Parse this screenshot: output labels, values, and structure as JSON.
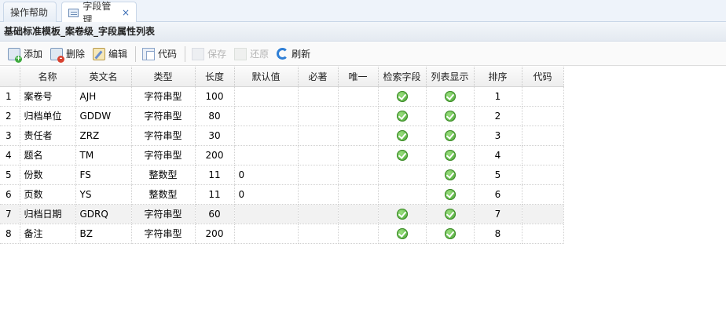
{
  "tabs": [
    {
      "label": "操作帮助"
    },
    {
      "label": "字段管理",
      "close": "×"
    }
  ],
  "panel": {
    "title": "基础标准模板_案卷级_字段属性列表"
  },
  "toolbar": {
    "add": "添加",
    "delete": "删除",
    "edit": "编辑",
    "code": "代码",
    "save": "保存",
    "revert": "还原",
    "refresh": "刷新"
  },
  "grid": {
    "columns": [
      "名称",
      "英文名",
      "类型",
      "长度",
      "默认值",
      "必著",
      "唯一",
      "检索字段",
      "列表显示",
      "排序",
      "代码"
    ],
    "rows": [
      {
        "n": "1",
        "name": "案卷号",
        "en": "AJH",
        "type": "字符串型",
        "len": "100",
        "def": "",
        "search": true,
        "list": true,
        "order": "1"
      },
      {
        "n": "2",
        "name": "归档单位",
        "en": "GDDW",
        "type": "字符串型",
        "len": "80",
        "def": "",
        "search": true,
        "list": true,
        "order": "2"
      },
      {
        "n": "3",
        "name": "责任者",
        "en": "ZRZ",
        "type": "字符串型",
        "len": "30",
        "def": "",
        "search": true,
        "list": true,
        "order": "3"
      },
      {
        "n": "4",
        "name": "题名",
        "en": "TM",
        "type": "字符串型",
        "len": "200",
        "def": "",
        "search": true,
        "list": true,
        "order": "4"
      },
      {
        "n": "5",
        "name": "份数",
        "en": "FS",
        "type": "整数型",
        "len": "11",
        "def": "0",
        "search": false,
        "list": true,
        "order": "5"
      },
      {
        "n": "6",
        "name": "页数",
        "en": "YS",
        "type": "整数型",
        "len": "11",
        "def": "0",
        "search": false,
        "list": true,
        "order": "6"
      },
      {
        "n": "7",
        "name": "归档日期",
        "en": "GDRQ",
        "type": "字符串型",
        "len": "60",
        "def": "",
        "search": true,
        "list": true,
        "order": "7"
      },
      {
        "n": "8",
        "name": "备注",
        "en": "BZ",
        "type": "字符串型",
        "len": "200",
        "def": "",
        "search": true,
        "list": true,
        "order": "8"
      }
    ],
    "highlighted_row": 7
  }
}
